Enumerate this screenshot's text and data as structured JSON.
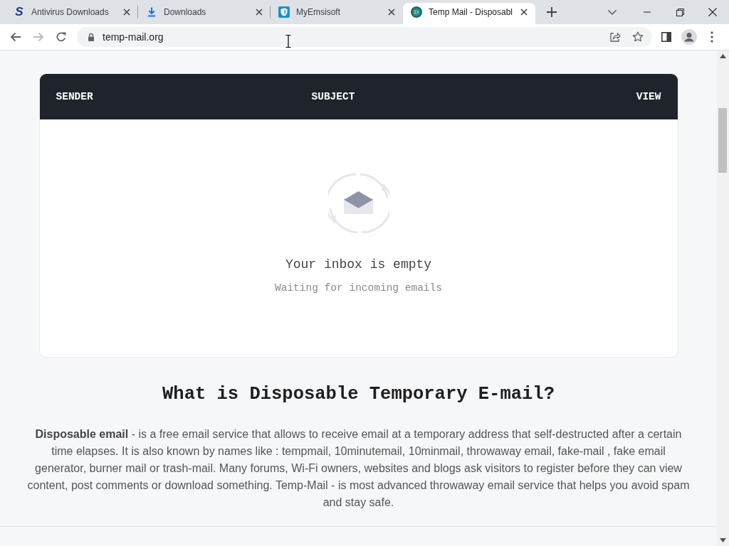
{
  "tabs": [
    {
      "title": "Antivirus Downloads",
      "kind": "letter",
      "logo_text": "S",
      "selected": false
    },
    {
      "title": "Downloads",
      "kind": "download",
      "selected": false
    },
    {
      "title": "MyEmsisoft",
      "kind": "shield",
      "selected": false
    },
    {
      "title": "Temp Mail - Disposabl",
      "kind": "round",
      "selected": true
    }
  ],
  "navigation": [
    {
      "kind": "back",
      "disabled": false
    },
    {
      "kind": "forward",
      "disabled": true
    },
    {
      "kind": "reload",
      "disabled": false
    }
  ],
  "address_bar": {
    "url": "temp-mail.org"
  },
  "inbox_table": {
    "columns": [
      "SENDER",
      "SUBJECT",
      "VIEW"
    ],
    "empty_title": "Your inbox is empty",
    "empty_subtitle": "Waiting for incoming emails"
  },
  "article": {
    "heading": "What is Disposable Temporary E-mail?",
    "paragraph": "**Disposable email** - is a free email service that allows to receive email at a temporary address that self-destructed after a certain time elapses. It is also known by names like : tempmail, 10minutemail, 10minmail, throwaway email, fake-mail , fake email generator, burner mail or trash-mail. Many forums, Wi-Fi owners, websites and blogs ask visitors to register before they can view content, post comments or download something. Temp-Mail - is most advanced throwaway email service that helps you avoid spam and stay safe."
  }
}
